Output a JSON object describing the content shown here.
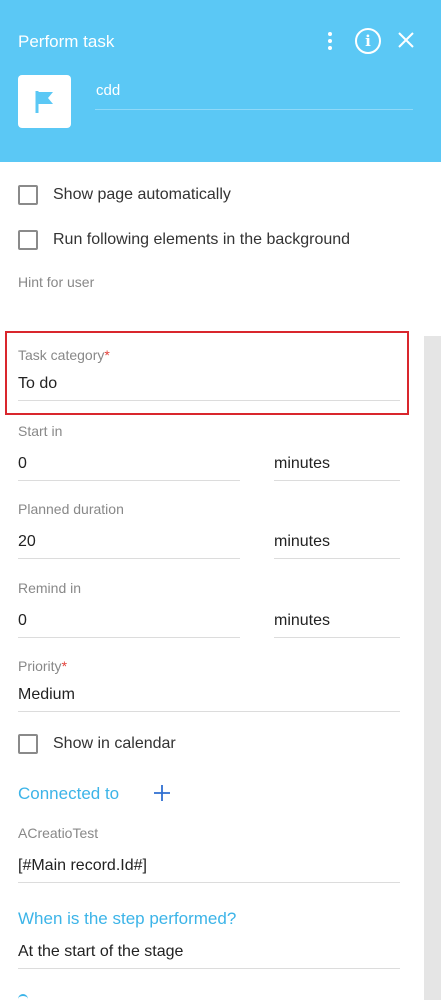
{
  "header": {
    "title": "Perform task",
    "task_name": "cdd"
  },
  "options": {
    "show_page_auto": "Show page automatically",
    "run_background": "Run following elements in the background"
  },
  "hint": {
    "label": "Hint for user"
  },
  "task_category": {
    "label": "Task category",
    "required_mark": "*",
    "value": "To do"
  },
  "start_in": {
    "label": "Start in",
    "value": "0",
    "unit": "minutes"
  },
  "planned_duration": {
    "label": "Planned duration",
    "value": "20",
    "unit": "minutes"
  },
  "remind_in": {
    "label": "Remind in",
    "value": "0",
    "unit": "minutes"
  },
  "priority": {
    "label": "Priority",
    "required_mark": "*",
    "value": "Medium"
  },
  "calendar": {
    "label": "Show in calendar"
  },
  "connected": {
    "heading": "Connected to",
    "field_label": "ACreatioTest",
    "field_value": "[#Main record.Id#]"
  },
  "step": {
    "heading": "When is the step performed?",
    "value": "At the start of the stage"
  },
  "colors": {
    "header_bg": "#5bc8f5",
    "accent": "#3cb4e8",
    "required": "#e3413a",
    "highlight": "#d9262d"
  }
}
